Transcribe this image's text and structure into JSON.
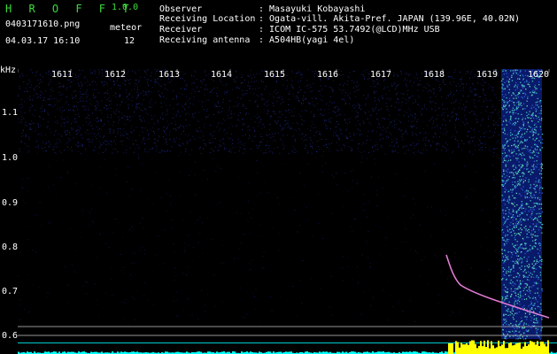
{
  "app": {
    "title": "H R O F F T",
    "version": "1.0.0",
    "filename": "0403171610.png",
    "datetime": "04.03.17 16:10",
    "detection_label": "meteor",
    "detection_count": "12"
  },
  "info": [
    {
      "label": "Observer",
      "value": ": Masayuki Kobayashi"
    },
    {
      "label": "Receiving Location",
      "value": ": Ogata-vill. Akita-Pref. JAPAN (139.96E, 40.02N)"
    },
    {
      "label": "Receiver",
      "value": ": ICOM IC-575 53.7492(@LCD)MHz USB"
    },
    {
      "label": "Receiving antenna",
      "value": ": A504HB(yagi 4el)"
    }
  ],
  "axis": {
    "y_unit": "kHz",
    "y_ticks": [
      "1.1",
      "1.0",
      "0.9",
      "0.8",
      "0.7",
      "0.6"
    ],
    "x_ticks": [
      "1611",
      "1612",
      "1613",
      "1614",
      "1615",
      "1616",
      "1617",
      "1618",
      "1619",
      "1620"
    ]
  },
  "colors": {
    "background": "#000000",
    "title_green": "#3cdc3c",
    "text_white": "#ffffff",
    "grid_grey": "#c8c8c8",
    "noise_blue": "#1e2a8c",
    "burst_cyan": "#40c0c0",
    "meteor_pink": "#ff60c0",
    "audio_yellow": "#ffff00",
    "audio_cyan": "#00ffff"
  }
}
